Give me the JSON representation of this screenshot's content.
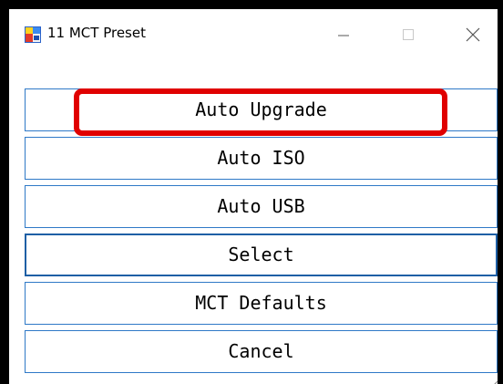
{
  "window": {
    "title": "11 MCT Preset",
    "app_icon": "app-window-icon",
    "controls": {
      "minimize_icon": "minimize-icon",
      "maximize_icon": "maximize-icon",
      "close_icon": "close-icon"
    }
  },
  "buttons": [
    {
      "label": "Auto Upgrade"
    },
    {
      "label": "Auto ISO"
    },
    {
      "label": "Auto USB"
    },
    {
      "label": "Select"
    },
    {
      "label": "MCT Defaults"
    },
    {
      "label": "Cancel"
    }
  ],
  "focused_button": "Select",
  "highlighted_button": "Auto Upgrade",
  "colors": {
    "button_border": "#2f79c7",
    "focus_border": "#1e5fa5",
    "highlight": "#e00000"
  }
}
